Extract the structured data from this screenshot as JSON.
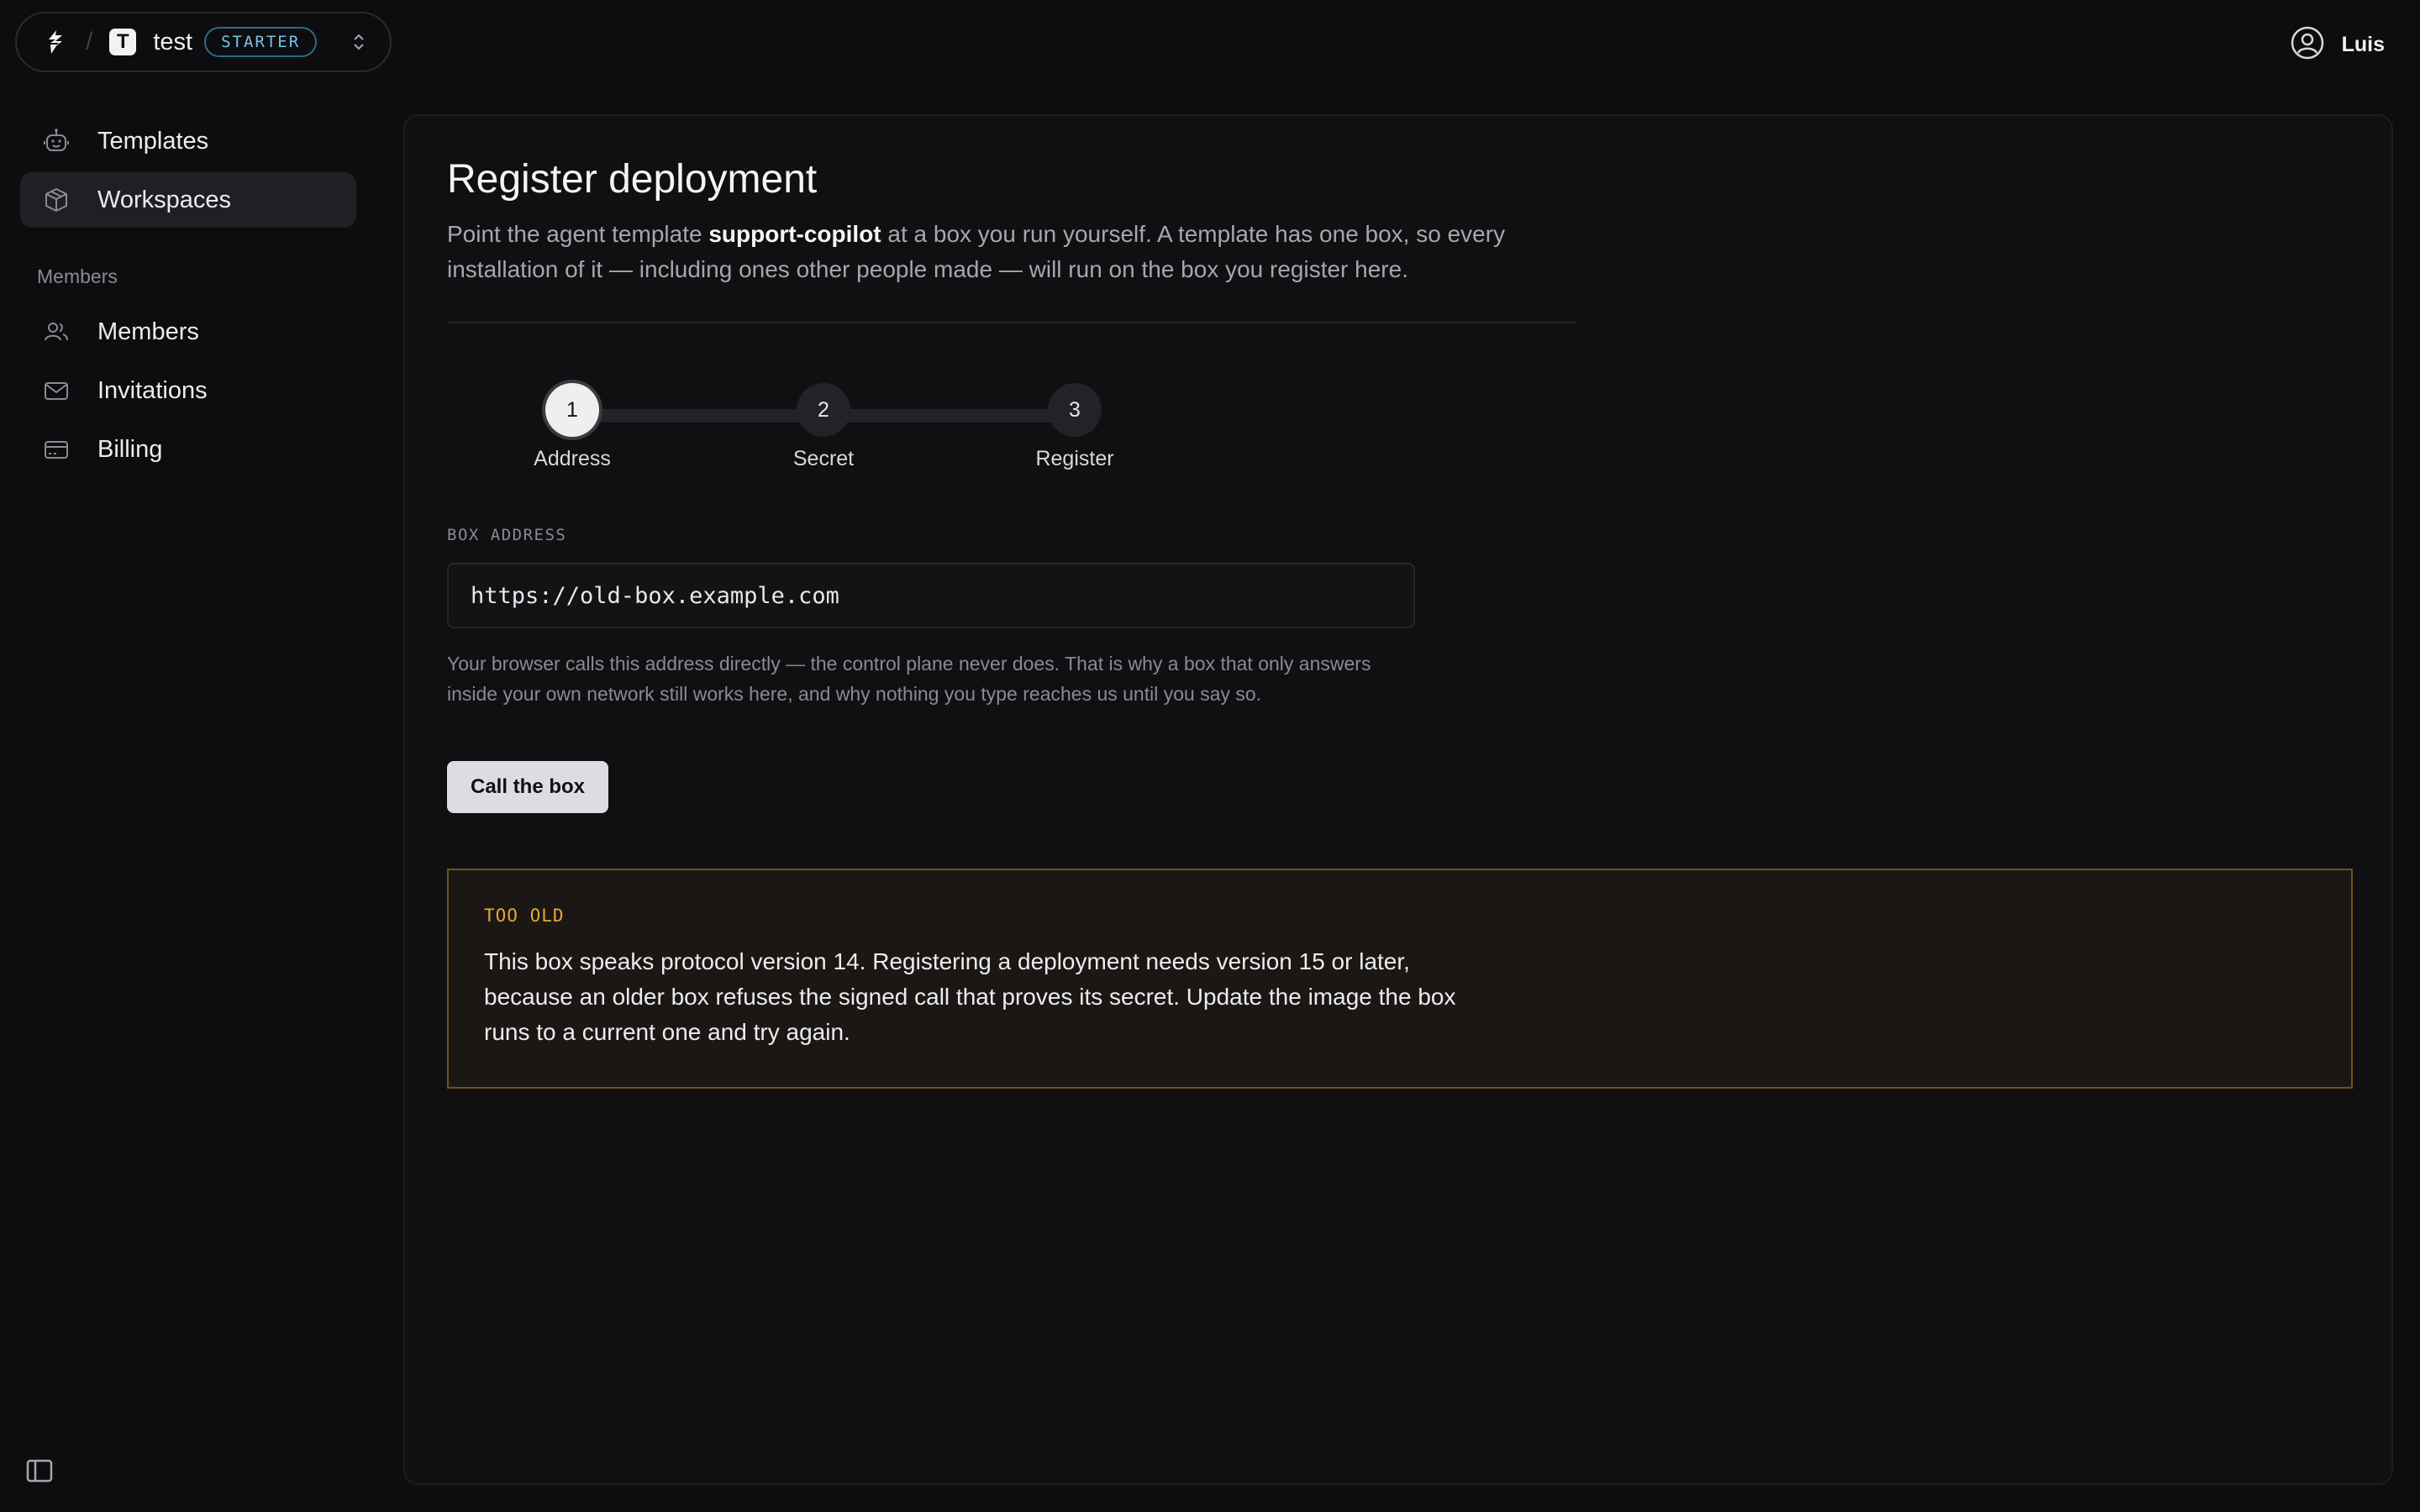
{
  "header": {
    "workspace_initial": "T",
    "workspace_name": "test",
    "plan_badge": "STARTER",
    "user_name": "Luis"
  },
  "sidebar": {
    "items": [
      {
        "label": "Templates",
        "icon": "robot-icon"
      },
      {
        "label": "Workspaces",
        "icon": "box-icon",
        "active": true
      }
    ],
    "section_label": "Members",
    "section_items": [
      {
        "label": "Members",
        "icon": "users-icon"
      },
      {
        "label": "Invitations",
        "icon": "mail-icon"
      },
      {
        "label": "Billing",
        "icon": "credit-card-icon"
      }
    ]
  },
  "main": {
    "title": "Register deployment",
    "desc_prefix": "Point the agent template ",
    "desc_template": "support-copilot",
    "desc_suffix": " at a box you run yourself. A template has one box, so every installation of it — including ones other people made — will run on the box you register here.",
    "stepper": {
      "current": 1,
      "steps": [
        {
          "number": "1",
          "label": "Address"
        },
        {
          "number": "2",
          "label": "Secret"
        },
        {
          "number": "3",
          "label": "Register"
        }
      ]
    },
    "field_label": "BOX ADDRESS",
    "field_value": "https://old-box.example.com",
    "field_help": "Your browser calls this address directly — the control plane never does. That is why a box that only answers inside your own network still works here, and why nothing you type reaches us until you say so.",
    "button_label": "Call the box",
    "warning": {
      "tag": "TOO OLD",
      "body": "This box speaks protocol version 14. Registering a deployment needs version 15 or later, because an older box refuses the signed call that proves its secret. Update the image the box runs to a current one and try again."
    }
  },
  "colors": {
    "background": "#0d0d0f",
    "panel": "#101012",
    "badge_accent": "#79c3e6",
    "warning_accent": "#e0a93a",
    "warning_border": "#6e5420"
  }
}
